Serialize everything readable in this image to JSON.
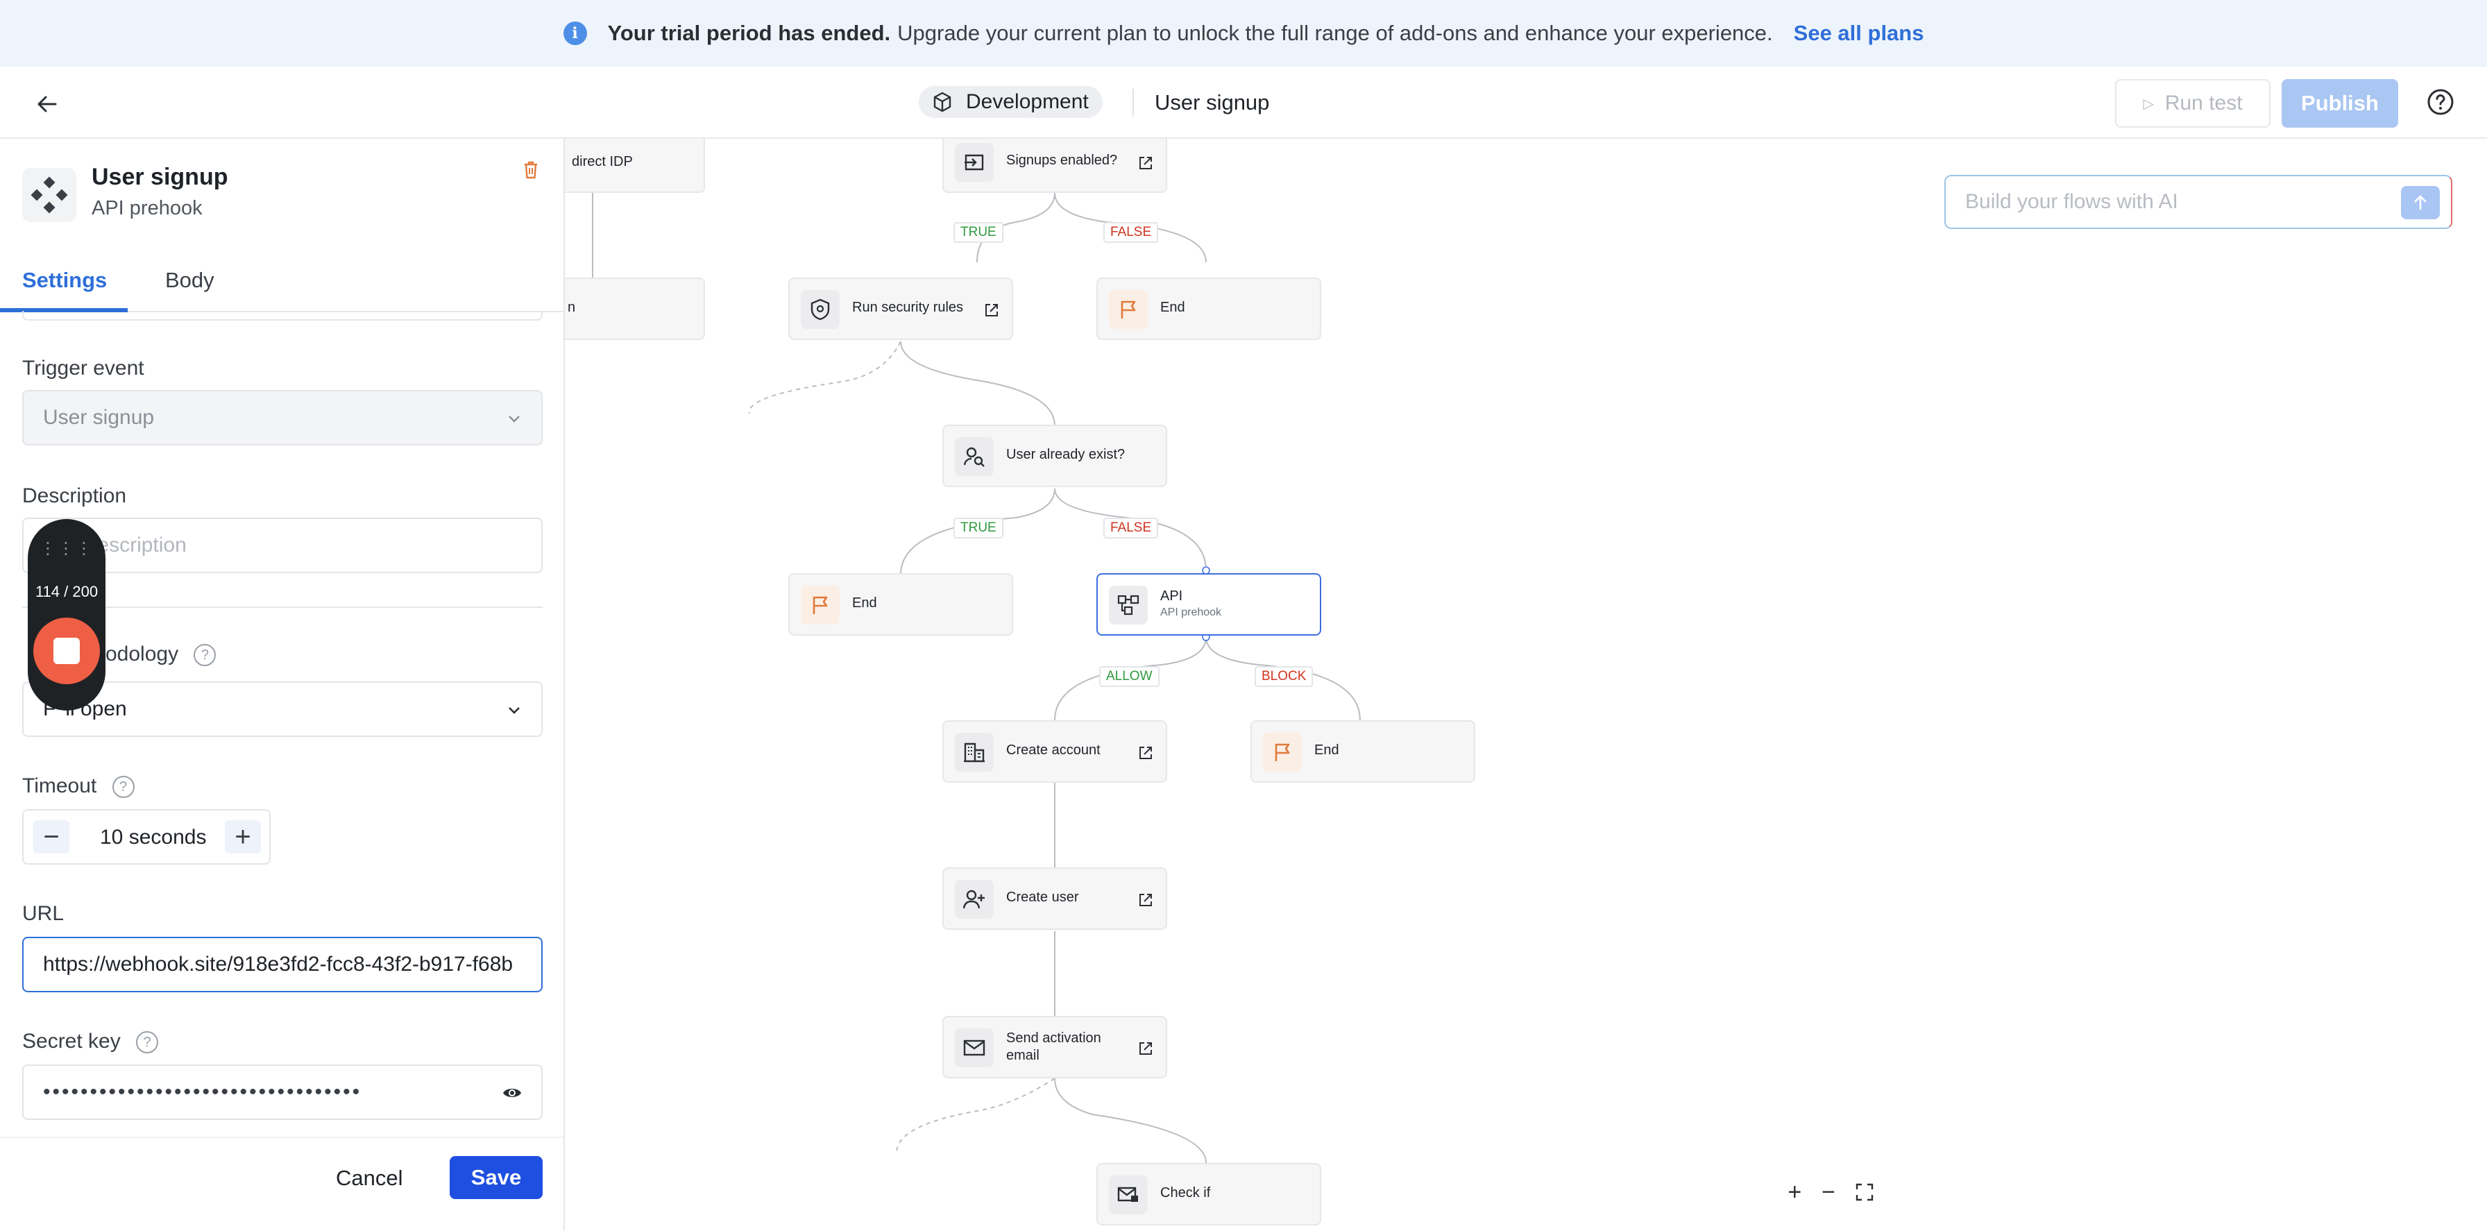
{
  "banner": {
    "bold": "Your trial period has ended.",
    "text": "Upgrade your current plan to unlock the full range of add-ons and enhance your experience.",
    "link": "See all plans",
    "icon": "info-icon"
  },
  "header": {
    "environment": "Development",
    "flow_name": "User signup",
    "run_test": "Run test",
    "publish": "Publish"
  },
  "panel": {
    "title": "User signup",
    "subtitle": "API prehook",
    "tabs": [
      "Settings",
      "Body"
    ],
    "active_tab": "Settings",
    "trigger_event": {
      "label": "Trigger event",
      "value": "User signup"
    },
    "description": {
      "label": "Description",
      "placeholder": "Add description"
    },
    "methodology": {
      "label": "Failure methodology",
      "visible_label": "odology",
      "value": "Fail open",
      "visible_value": "F",
      "visible_value_tail": "il open"
    },
    "timeout": {
      "label": "Timeout",
      "value": "10 seconds"
    },
    "url": {
      "label": "URL",
      "value": "https://webhook.site/918e3fd2-fcc8-43f2-b917-f68b"
    },
    "secret_key": {
      "label": "Secret key",
      "value": "••••••••••••••••••••••••••••••••••"
    },
    "cancel": "Cancel",
    "save": "Save"
  },
  "recorder": {
    "count": "114 / 200"
  },
  "canvas": {
    "ai_placeholder": "Build your flows with AI",
    "nodes": {
      "redirect": "direct IDP",
      "partial": "n",
      "signups": "Signups enabled?",
      "security": "Run security rules",
      "end1": "End",
      "exists": "User already exist?",
      "end2": "End",
      "api": "API",
      "api_sub": "API prehook",
      "create_account": "Create account",
      "end3": "End",
      "create_user": "Create user",
      "activation": "Send activation email",
      "check": "Check if"
    },
    "chips": {
      "true1": "TRUE",
      "false1": "FALSE",
      "true2": "TRUE",
      "false2": "FALSE",
      "allow": "ALLOW",
      "block": "BLOCK"
    }
  },
  "colors": {
    "accent": "#2e6fd9",
    "save": "#1e4fe0",
    "publish": "#aac6f2",
    "true": "#2e9a3e",
    "false": "#d2331f",
    "end_icon": "#e07a3a"
  }
}
